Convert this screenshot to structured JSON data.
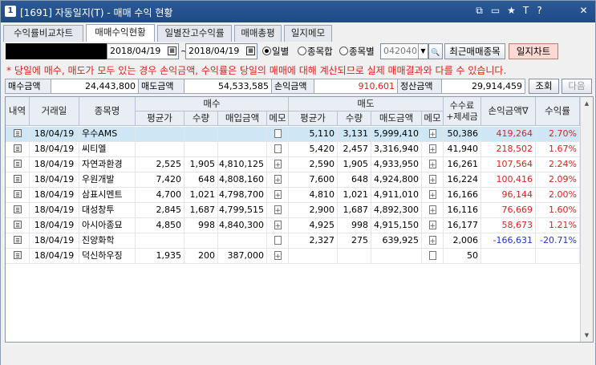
{
  "window": {
    "title": "[1691] 자동일지(T) - 매매 수익 현황",
    "app_icon": "1",
    "controls": [
      "restore-icon",
      "window-icon",
      "star-icon",
      "font-icon",
      "help-icon",
      "close-icon"
    ],
    "control_glyphs": [
      "⧉",
      "▭",
      "★",
      "T",
      "?",
      "✕"
    ]
  },
  "tabs": [
    {
      "label": "수익률비교차트",
      "active": false
    },
    {
      "label": "매매수익현황",
      "active": true
    },
    {
      "label": "일별잔고수익률",
      "active": false
    },
    {
      "label": "매매총평",
      "active": false
    },
    {
      "label": "일지메모",
      "active": false
    }
  ],
  "filter": {
    "date_from": "2018/04/19",
    "date_to": "2018/04/19",
    "tilde": "~",
    "calendar_glyph": "▦",
    "radios": [
      {
        "label": "일별",
        "checked": true
      },
      {
        "label": "종목합",
        "checked": false
      },
      {
        "label": "종목별",
        "checked": false
      }
    ],
    "stock_code": "042040",
    "dropdown_glyph": "▼",
    "search_glyph": "🔍",
    "recent_trade_button": "최근매매종목",
    "chart_button": "일지차트"
  },
  "notice": "* 당일에 매수, 매도가 모두 있는 경우 손익금액, 수익률은 당일의 매매에 대해 계산되므로 실제 매매결과와 다를 수 있습니다.",
  "summary": {
    "buy_label": "매수금액",
    "buy_value": "24,443,800",
    "sell_label": "매도금액",
    "sell_value": "54,533,585",
    "pnl_label": "손익금액",
    "pnl_value": "910,601",
    "settle_label": "정산금액",
    "settle_value": "29,914,459",
    "query_button": "조회",
    "next_button": "다음"
  },
  "colors": {
    "accent": "#1f4a86",
    "profit": "#e0201a",
    "loss": "#1a35d0",
    "selected_row": "#cfe7f5"
  },
  "grid": {
    "headers": {
      "detail": "내역",
      "date": "거래일",
      "name": "종목명",
      "buy_group": "매수",
      "sell_group": "매도",
      "fee": "수수료\n+제세금",
      "pnl": "손익금액",
      "pnl_sort_glyph": "∇",
      "rate": "수익률",
      "buy_avg": "평균가",
      "buy_qty": "수량",
      "buy_amount": "매입금액",
      "buy_memo": "메모",
      "sell_avg": "평균가",
      "sell_qty": "수량",
      "sell_amount": "매도금액",
      "sell_memo": "메모"
    },
    "rows": [
      {
        "date": "18/04/19",
        "name": "우수AMS",
        "buy_avg": "",
        "buy_qty": "",
        "buy_amt": "",
        "buy_memo": "doc",
        "sell_avg": "5,110",
        "sell_qty": "3,131",
        "sell_amt": "5,999,410",
        "sell_memo": "plus",
        "fee": "50,386",
        "pnl": "419,264",
        "rate": "2.70%",
        "sign": "pos",
        "selected": true
      },
      {
        "date": "18/04/19",
        "name": "씨티엘",
        "buy_avg": "",
        "buy_qty": "",
        "buy_amt": "",
        "buy_memo": "doc",
        "sell_avg": "5,420",
        "sell_qty": "2,457",
        "sell_amt": "3,316,940",
        "sell_memo": "plus",
        "fee": "41,940",
        "pnl": "218,502",
        "rate": "1.67%",
        "sign": "pos",
        "selected": false
      },
      {
        "date": "18/04/19",
        "name": "자연과환경",
        "buy_avg": "2,525",
        "buy_qty": "1,905",
        "buy_amt": "4,810,125",
        "buy_memo": "plus",
        "sell_avg": "2,590",
        "sell_qty": "1,905",
        "sell_amt": "4,933,950",
        "sell_memo": "plus",
        "fee": "16,261",
        "pnl": "107,564",
        "rate": "2.24%",
        "sign": "pos",
        "selected": false
      },
      {
        "date": "18/04/19",
        "name": "우원개발",
        "buy_avg": "7,420",
        "buy_qty": "648",
        "buy_amt": "4,808,160",
        "buy_memo": "plus",
        "sell_avg": "7,600",
        "sell_qty": "648",
        "sell_amt": "4,924,800",
        "sell_memo": "plus",
        "fee": "16,224",
        "pnl": "100,416",
        "rate": "2.09%",
        "sign": "pos",
        "selected": false
      },
      {
        "date": "18/04/19",
        "name": "삼표시멘트",
        "buy_avg": "4,700",
        "buy_qty": "1,021",
        "buy_amt": "4,798,700",
        "buy_memo": "plus",
        "sell_avg": "4,810",
        "sell_qty": "1,021",
        "sell_amt": "4,911,010",
        "sell_memo": "plus",
        "fee": "16,166",
        "pnl": "96,144",
        "rate": "2.00%",
        "sign": "pos",
        "selected": false
      },
      {
        "date": "18/04/19",
        "name": "대성창투",
        "buy_avg": "2,845",
        "buy_qty": "1,687",
        "buy_amt": "4,799,515",
        "buy_memo": "plus",
        "sell_avg": "2,900",
        "sell_qty": "1,687",
        "sell_amt": "4,892,300",
        "sell_memo": "plus",
        "fee": "16,116",
        "pnl": "76,669",
        "rate": "1.60%",
        "sign": "pos",
        "selected": false
      },
      {
        "date": "18/04/19",
        "name": "아시아종묘",
        "buy_avg": "4,850",
        "buy_qty": "998",
        "buy_amt": "4,840,300",
        "buy_memo": "plus",
        "sell_avg": "4,925",
        "sell_qty": "998",
        "sell_amt": "4,915,150",
        "sell_memo": "plus",
        "fee": "16,177",
        "pnl": "58,673",
        "rate": "1.21%",
        "sign": "pos",
        "selected": false
      },
      {
        "date": "18/04/19",
        "name": "진양화학",
        "buy_avg": "",
        "buy_qty": "",
        "buy_amt": "",
        "buy_memo": "doc",
        "sell_avg": "2,327",
        "sell_qty": "275",
        "sell_amt": "639,925",
        "sell_memo": "plus",
        "fee": "2,006",
        "pnl": "-166,631",
        "rate": "-20.71%",
        "sign": "neg",
        "selected": false
      },
      {
        "date": "18/04/19",
        "name": "덕신하우징",
        "buy_avg": "1,935",
        "buy_qty": "200",
        "buy_amt": "387,000",
        "buy_memo": "plus",
        "sell_avg": "",
        "sell_qty": "",
        "sell_amt": "",
        "sell_memo": "doc",
        "fee": "50",
        "pnl": "",
        "rate": "",
        "sign": "none",
        "selected": false
      }
    ]
  }
}
